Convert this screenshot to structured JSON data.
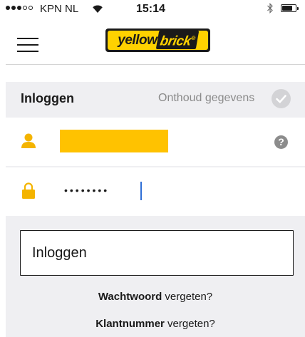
{
  "status_bar": {
    "carrier": "KPN NL",
    "time": "15:14",
    "signal_bars_filled": 3,
    "signal_bars_total": 5
  },
  "header": {
    "logo_text_1": "yellow",
    "logo_text_2": "brick",
    "logo_symbol": "®"
  },
  "login": {
    "title": "Inloggen",
    "remember_label": "Onthoud gegevens",
    "password_mask": "••••••••",
    "help_symbol": "?",
    "submit_label": "Inloggen",
    "forgot_password_bold": "Wachtwoord",
    "forgot_password_rest": " vergeten?",
    "forgot_customer_bold": "Klantnummer",
    "forgot_customer_rest": " vergeten?"
  },
  "colors": {
    "brand_yellow": "#ffd200",
    "redaction": "#ffc200",
    "panel_bg": "#efeff2",
    "caret": "#2f6fd6"
  },
  "icons": [
    "wifi-icon",
    "bluetooth-icon",
    "battery-icon",
    "menu-icon",
    "user-icon",
    "lock-icon",
    "help-icon",
    "checkmark-icon"
  ]
}
